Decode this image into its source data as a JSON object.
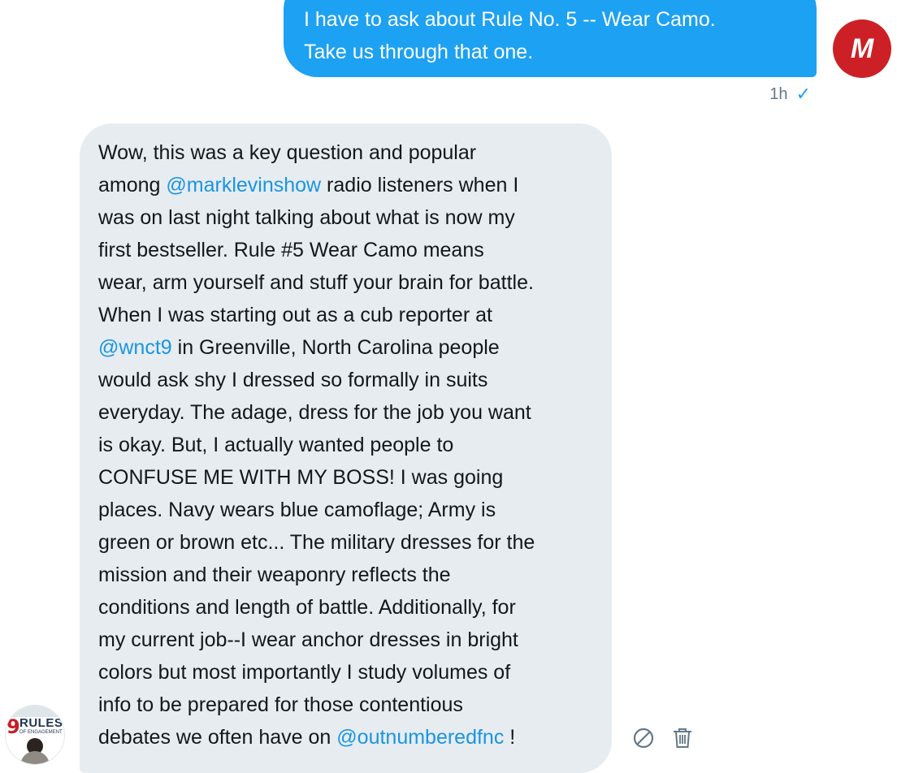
{
  "sent_message": {
    "lines": [
      "I have to ask about Rule No. 5 -- Wear Camo.",
      "Take us through that one."
    ],
    "time": "1h",
    "status_icon": "check-icon"
  },
  "sender_avatar": {
    "letter": "M",
    "color": "#cc2026"
  },
  "received_message": {
    "line_1": "Wow, this was a key question and popular",
    "line_2_prefix": "among ",
    "line_2_mention": "@marklevinshow",
    "line_2_suffix": " radio listeners when I",
    "line_3": "was on last night talking about what is now my",
    "line_4": "first bestseller.  Rule #5 Wear Camo means",
    "line_5": "wear, arm yourself and stuff your brain for battle.",
    "line_6": "When I was starting out as a cub reporter at",
    "line_7_mention": "@wnct9",
    "line_7_suffix": " in Greenville, North Carolina people",
    "line_8": "would ask shy I dressed so formally in suits",
    "line_9": "everyday. The adage, dress for the job you want",
    "line_10": "is okay.  But, I actually wanted people to",
    "line_11": "CONFUSE ME WITH MY BOSS!  I was going",
    "line_12": "places.   Navy wears blue camoflage; Army is",
    "line_13": "green or brown etc... The military dresses for the",
    "line_14": "mission and their weaponry reflects the",
    "line_15": "conditions and length of battle.  Additionally, for",
    "line_16": "my current job--I wear anchor dresses in bright",
    "line_17": "colors but most importantly I study volumes of",
    "line_18": "info to be prepared for those contentious",
    "line_19_prefix": "debates we often have on ",
    "line_19_mention": "@outnumberedfnc",
    "line_19_suffix": " !"
  },
  "recipient_avatar": {
    "number": "9",
    "word": "RULES",
    "subtitle": "OF ENGAGEMENT"
  },
  "actions": {
    "report_icon": "block-icon",
    "delete_icon": "trash-icon"
  },
  "colors": {
    "sent_bubble": "#1da1f2",
    "received_bubble": "#e6ecf0",
    "mention": "#1b95e0",
    "meta": "#657786"
  }
}
